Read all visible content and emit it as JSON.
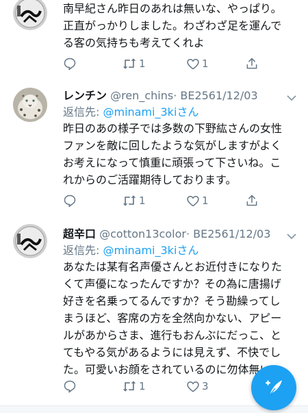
{
  "tweets": [
    {
      "text_lines": [
        "南早紀さん昨日のあれは無いな、やっぱり。",
        "正直がっかりしました。わざわざ足を運んで",
        "る客の気持ちも考えてくれよ"
      ],
      "avatar_icon": "kanji-logo-avatar",
      "actions": {
        "reply": "",
        "retweet": "1",
        "like": "1",
        "share": ""
      }
    },
    {
      "display_name": "レンチン",
      "handle": "@ren_chins",
      "date": "· BE2561/12/03",
      "reply_prefix": "返信先: ",
      "reply_mention": "@minami_3kiさん",
      "avatar_icon": "snow-leopard-avatar",
      "text_lines": [
        "昨日のあの様子では多数の下野紘さんの女性",
        "ファンを敵に回したような気がしますがよく",
        "お考えになって慎重に頑張って下さいね。こ",
        "れからのご活躍期待しております。"
      ],
      "actions": {
        "reply": "",
        "retweet": "1",
        "like": "1",
        "share": ""
      }
    },
    {
      "display_name": "超辛口",
      "handle": "@cotton13color",
      "date": "· BE2561/12/03",
      "reply_prefix": "返信先: ",
      "reply_mention": "@minami_3kiさん",
      "avatar_icon": "kanji-logo-avatar",
      "text_lines": [
        "あなたは某有名声優さんとお近付きになりた",
        "くて声優になったんですか？その為に唐揚げ",
        "好きを名乗ってるんですか？そう勘繰ってし",
        "まうほど、客席の方を全然向かない、アピー",
        "ルがあからさま、進行もおんぶにだっこ、と",
        "てもやる気があるようには見えず、不快でし",
        "た。可愛いお顔をされているのに勿体無い。"
      ],
      "actions": {
        "reply": "",
        "retweet": "1",
        "like": "3",
        "share": ""
      }
    }
  ],
  "fab": {
    "icon": "compose-tweet-icon"
  },
  "colors": {
    "accent": "#1da1f2",
    "muted": "#657786",
    "text": "#14171a",
    "divider": "#e6ecf0"
  }
}
